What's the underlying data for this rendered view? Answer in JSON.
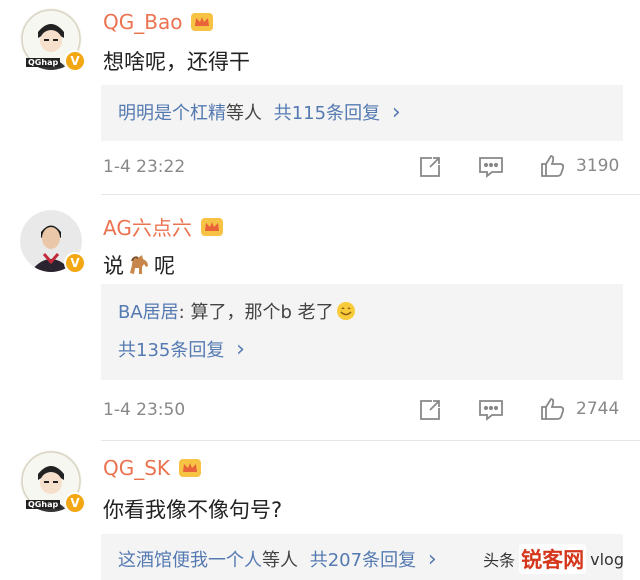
{
  "comments": [
    {
      "username": "QG_Bao",
      "text": "想啥呢，还得干",
      "reply": {
        "preview_author": "明明是个杠精",
        "preview_suffix": "等人",
        "count_text": "共115条回复",
        "chevron": "›"
      },
      "time": "1-4 23:22",
      "likes": "3190",
      "avatar_text": "QGhap"
    },
    {
      "username": "AG六点六",
      "text_before": "说",
      "text_after": "呢",
      "emoji": "horse-icon",
      "reply": {
        "author": "BA居居",
        "colon_text": ": 算了，那个b 老了",
        "emoji": "smile-icon",
        "count_text": "共135条回复",
        "chevron": "›"
      },
      "time": "1-4 23:50",
      "likes": "2744"
    },
    {
      "username": "QG_SK",
      "text": "你看我像不像句号?",
      "reply": {
        "preview_author": "这酒馆便我一个人",
        "preview_suffix": "等人",
        "count_text": "共207条回复",
        "chevron": "›"
      },
      "avatar_text": "QGhap"
    }
  ],
  "watermark": {
    "prefix": "头条",
    "logo": "锐客网",
    "suffix": "vlog"
  },
  "colors": {
    "username": "#eb7350",
    "link": "#557ab2",
    "meta": "#888888",
    "reply_bg": "#f4f4f4"
  }
}
